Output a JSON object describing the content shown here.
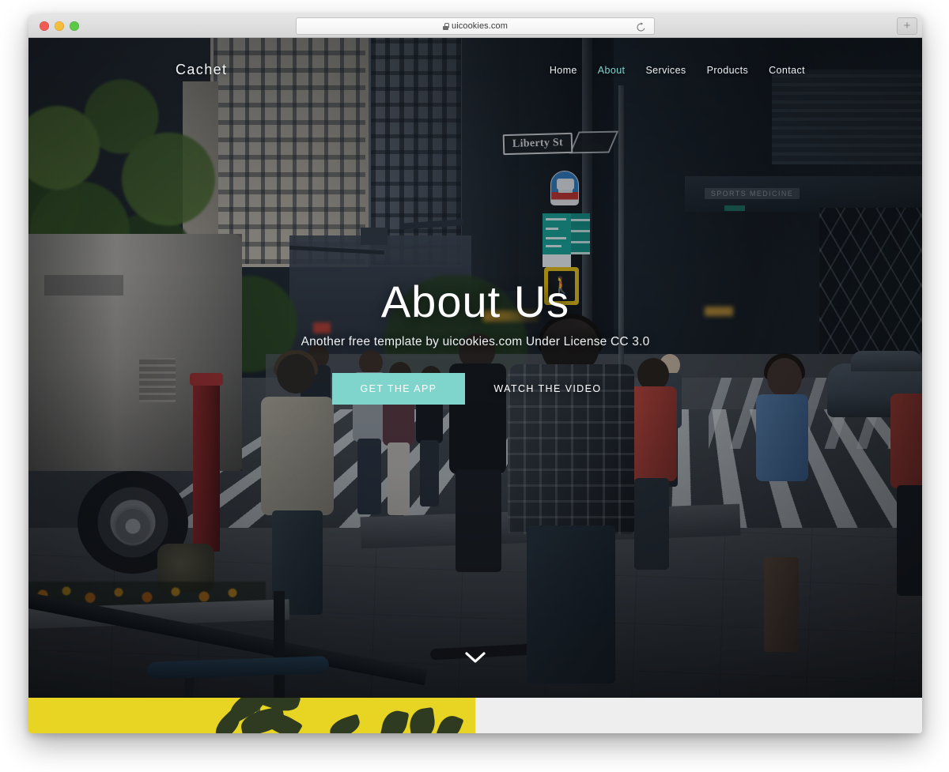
{
  "browser": {
    "traffic_lights": [
      "close",
      "minimize",
      "zoom"
    ],
    "url": "uicookies.com",
    "secure_icon": "lock-icon",
    "reload_icon": "reload-icon",
    "new_tab_label": "+"
  },
  "site": {
    "brand": "Cachet",
    "nav": [
      {
        "label": "Home",
        "active": false
      },
      {
        "label": "About",
        "active": true
      },
      {
        "label": "Services",
        "active": false
      },
      {
        "label": "Products",
        "active": false
      },
      {
        "label": "Contact",
        "active": false
      }
    ],
    "hero": {
      "title": "About Us",
      "subtitle": "Another free template by uicookies.com Under License CC 3.0",
      "primary_button": "GET THE APP",
      "secondary_button": "WATCH THE VIDEO",
      "scroll_icon": "chevron-down-icon",
      "background_photo": "city-street-crosswalk-pedestrians"
    },
    "next_section": {
      "yellow_panel_color": "#E8D422",
      "grey_panel_color": "#EEEEEE",
      "yellow_panel_photo": "plant-leaves-on-yellow"
    }
  },
  "colors": {
    "accent_teal": "#7FD4CC",
    "nav_active": "#7FD4CC",
    "yellow": "#E8D422",
    "hero_text": "#FFFFFF"
  },
  "street_signs": {
    "street_name": "Liberty St",
    "storefront_sign": "SPORTS MEDICINE"
  }
}
